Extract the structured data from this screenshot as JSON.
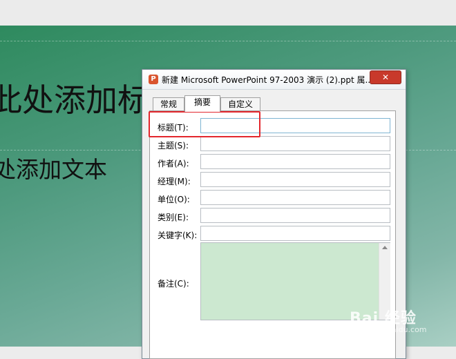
{
  "slide": {
    "title_placeholder": "此处添加标",
    "text_placeholder": "处添加文本"
  },
  "dialog": {
    "title": "新建 Microsoft PowerPoint 97-2003 演示 (2).ppt 属...",
    "app_icon_glyph": "P",
    "close_glyph": "✕",
    "tabs": [
      {
        "label": "常规"
      },
      {
        "label": "摘要"
      },
      {
        "label": "自定义"
      }
    ],
    "active_tab": "摘要",
    "fields": [
      {
        "label": "标题(T):",
        "value": ""
      },
      {
        "label": "主题(S):",
        "value": ""
      },
      {
        "label": "作者(A):",
        "value": ""
      },
      {
        "label": "经理(M):",
        "value": ""
      },
      {
        "label": "单位(O):",
        "value": ""
      },
      {
        "label": "类别(E):",
        "value": ""
      },
      {
        "label": "关键字(K):",
        "value": ""
      }
    ],
    "notes_label": "备注(C):",
    "notes_value": ""
  },
  "colors": {
    "highlight": "#e3262c",
    "notes_bg": "#cce8d0",
    "slide_green": "#2e8a5e"
  },
  "watermark": {
    "brand": "Bai 经验",
    "url": "jingyan.baidu.com"
  }
}
